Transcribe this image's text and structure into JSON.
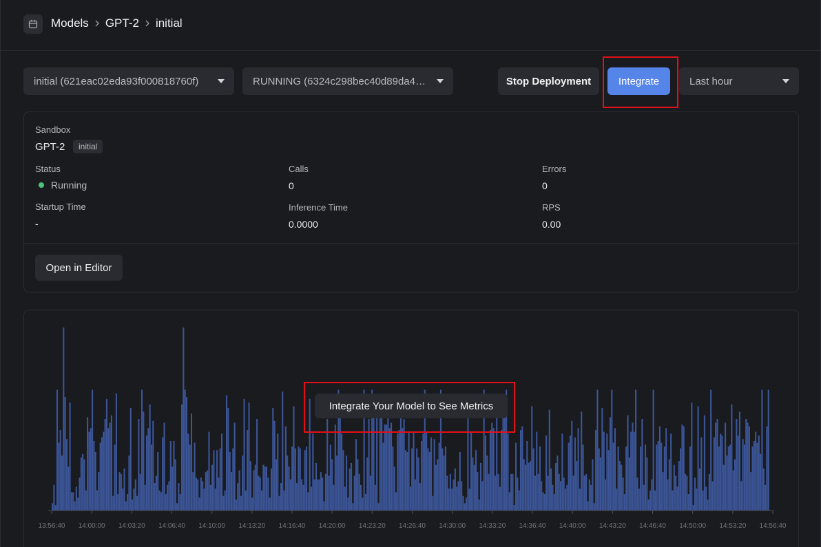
{
  "breadcrumb": {
    "items": [
      "Models",
      "GPT-2",
      "initial"
    ]
  },
  "controls": {
    "version_select": "initial (621eac02eda93f000818760f)",
    "deployment_select": "RUNNING (6324c298bec40d89da4…",
    "stop_label": "Stop Deployment",
    "integrate_label": "Integrate",
    "range_select": "Last hour"
  },
  "info": {
    "env_label": "Sandbox",
    "model_name": "GPT-2",
    "version_badge": "initial",
    "status_label": "Status",
    "status_value": "Running",
    "calls_label": "Calls",
    "calls_value": "0",
    "errors_label": "Errors",
    "errors_value": "0",
    "startup_label": "Startup Time",
    "startup_value": "-",
    "inference_label": "Inference Time",
    "inference_value": "0.0000",
    "rps_label": "RPS",
    "rps_value": "0.00",
    "editor_button": "Open in Editor"
  },
  "overlay": {
    "message": "Integrate Your Model to See Metrics"
  },
  "colors": {
    "accent": "#5585e8",
    "bars": "#3b5597",
    "status_running": "#4ec27a",
    "highlight": "#e3101a"
  },
  "chart_data": {
    "type": "bar",
    "x_tick_labels": [
      "13:56:40",
      "14:00:00",
      "14:03:20",
      "14:06:40",
      "14:10:00",
      "14:13:20",
      "14:16:40",
      "14:20:00",
      "14:23:20",
      "14:26:40",
      "14:30:00",
      "14:33:20",
      "14:36:40",
      "14:40:00",
      "14:43:20",
      "14:46:40",
      "14:50:00",
      "14:53:20",
      "14:56:40"
    ],
    "values": [
      0.04,
      0.14,
      0.03,
      0.66,
      0.37,
      0.44,
      0.3,
      1.0,
      0.62,
      0.39,
      0.24,
      0.59,
      0.1,
      0.1,
      0.05,
      0.13,
      0.07,
      0.18,
      0.29,
      0.31,
      0.28,
      0.11,
      0.51,
      0.43,
      0.45,
      0.66,
      0.38,
      0.32,
      0.11,
      0.21,
      0.37,
      0.4,
      0.43,
      0.5,
      0.61,
      0.45,
      0.48,
      0.52,
      0.08,
      0.36,
      0.64,
      0.09,
      0.21,
      0.2,
      0.12,
      0.23,
      0.05,
      0.09,
      0.3,
      0.56,
      0.06,
      0.12,
      0.17,
      0.08,
      0.5,
      0.2,
      0.66,
      0.54,
      0.14,
      0.41,
      0.45,
      0.58,
      0.36,
      0.49,
      0.15,
      0.19,
      0.32,
      0.11,
      0.1,
      0.4,
      0.48,
      0.09,
      0.14,
      0.16,
      0.38,
      0.24,
      0.38,
      0.28,
      0.04,
      0.15,
      0.09,
      0.58,
      1.0,
      0.66,
      0.62,
      0.42,
      0.36,
      0.53,
      0.21,
      0.37,
      0.18,
      0.17,
      0.07,
      0.18,
      0.16,
      0.12,
      0.21,
      0.22,
      0.43,
      0.14,
      0.25,
      0.33,
      0.12,
      0.33,
      0.18,
      0.34,
      0.42,
      0.08,
      0.11,
      0.63,
      0.56,
      0.32,
      0.21,
      0.34,
      0.48,
      0.06,
      0.15,
      0.22,
      0.08,
      0.3,
      0.61,
      0.11,
      0.44,
      0.59,
      0.27,
      0.07,
      0.22,
      0.25,
      0.5,
      0.19,
      0.18,
      0.11,
      0.25,
      0.24,
      0.24,
      0.18,
      0.07,
      0.23,
      0.56,
      0.49,
      0.28,
      0.42,
      0.08,
      0.15,
      0.65,
      0.11,
      0.46,
      0.3,
      0.24,
      0.17,
      0.35,
      0.57,
      0.34,
      0.15,
      0.35,
      0.34,
      0.17,
      0.14,
      0.33,
      0.35,
      0.1,
      0.61,
      0.13,
      0.42,
      0.17,
      0.26,
      0.17,
      0.17,
      0.21,
      0.18,
      0.05,
      0.2,
      0.5,
      0.19,
      0.36,
      0.28,
      0.14,
      0.47,
      0.3,
      0.66,
      0.52,
      0.42,
      0.33,
      0.13,
      0.3,
      0.07,
      0.23,
      0.26,
      0.04,
      0.19,
      0.39,
      0.28,
      0.2,
      0.14,
      0.07,
      0.66,
      0.09,
      0.29,
      0.5,
      0.19,
      0.66,
      0.51,
      0.14,
      0.52,
      0.04,
      0.56,
      0.51,
      0.37,
      0.47,
      0.47,
      0.59,
      0.45,
      0.48,
      0.35,
      0.24,
      0.1,
      0.42,
      0.44,
      0.6,
      0.45,
      0.5,
      0.33,
      0.32,
      0.43,
      0.13,
      0.34,
      0.43,
      0.17,
      0.34,
      0.29,
      0.15,
      0.38,
      0.42,
      0.66,
      0.43,
      0.34,
      0.32,
      0.4,
      0.08,
      0.39,
      0.25,
      0.28,
      0.37,
      0.66,
      0.34,
      0.3,
      0.35,
      0.19,
      0.12,
      0.2,
      0.12,
      0.17,
      0.23,
      0.13,
      0.16,
      0.32,
      0.16,
      0.08,
      0.04,
      0.07,
      0.59,
      0.12,
      0.43,
      0.29,
      0.25,
      0.33,
      0.21,
      0.06,
      0.26,
      0.16,
      0.66,
      0.41,
      0.3,
      0.2,
      0.44,
      0.48,
      0.45,
      0.19,
      0.55,
      0.2,
      0.13,
      0.44,
      0.54,
      0.61,
      0.66,
      0.42,
      0.1,
      0.2,
      0.2,
      0.03,
      0.37,
      0.18,
      0.11,
      0.44,
      0.46,
      0.28,
      0.25,
      0.38,
      0.26,
      0.27,
      0.57,
      0.34,
      0.19,
      0.43,
      0.2,
      0.35,
      0.16,
      0.1,
      0.09,
      0.41,
      0.19,
      0.55,
      0.23,
      0.14,
      0.09,
      0.26,
      0.3,
      0.2,
      0.16,
      0.42,
      0.18,
      0.12,
      0.14,
      0.37,
      0.41,
      0.49,
      0.19,
      0.4,
      0.27,
      0.45,
      0.12,
      0.54,
      0.36,
      0.19,
      0.2,
      0.05,
      0.17,
      0.14,
      0.28,
      0.04,
      0.44,
      0.66,
      0.34,
      0.29,
      0.56,
      0.43,
      0.17,
      0.42,
      0.33,
      0.51,
      0.66,
      0.37,
      0.45,
      0.12,
      0.35,
      0.27,
      0.25,
      0.18,
      0.09,
      0.35,
      0.52,
      0.29,
      0.43,
      0.48,
      0.43,
      0.66,
      0.18,
      0.12,
      0.35,
      0.5,
      0.14,
      0.36,
      0.29,
      0.06,
      0.11,
      0.17,
      0.66,
      0.11,
      0.36,
      0.38,
      0.46,
      0.37,
      0.21,
      0.35,
      0.45,
      0.17,
      0.28,
      0.42,
      0.11,
      0.25,
      0.19,
      0.13,
      0.27,
      0.34,
      0.47,
      0.46,
      0.2,
      0.19,
      0.09,
      0.35,
      0.59,
      0.03,
      0.18,
      0.12,
      0.57,
      0.23,
      0.4,
      0.11,
      0.52,
      0.13,
      0.06,
      0.2,
      0.66,
      0.16,
      0.4,
      0.48,
      0.5,
      0.35,
      0.42,
      0.41,
      0.25,
      0.48,
      0.3,
      0.35,
      0.36,
      0.58,
      0.22,
      0.28,
      0.5,
      0.41,
      0.54,
      0.16,
      0.39,
      0.36,
      0.5,
      0.48,
      0.46,
      0.21,
      0.35,
      0.38,
      0.43,
      0.37,
      0.41,
      0.31,
      0.66,
      0.23,
      0.14,
      0.46,
      0.66
    ]
  }
}
